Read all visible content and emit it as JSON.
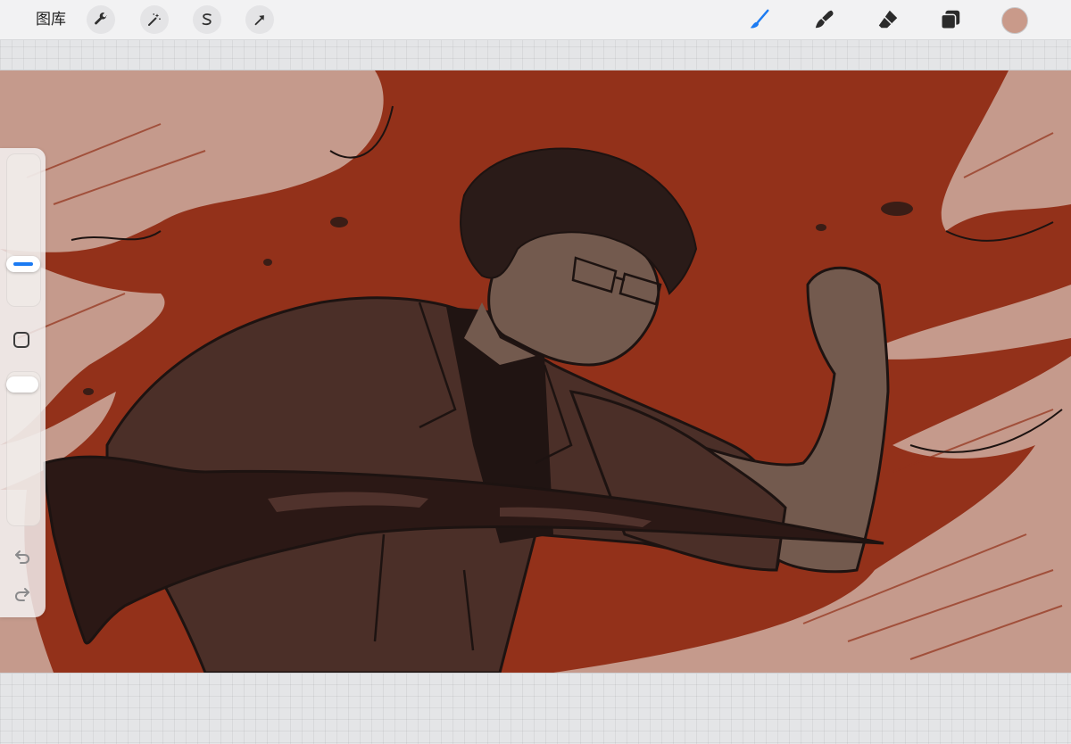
{
  "topbar": {
    "gallery_label": "图库",
    "left_tools": [
      {
        "name": "actions",
        "icon": "wrench-icon"
      },
      {
        "name": "adjustments",
        "icon": "magic-wand-icon"
      },
      {
        "name": "selection",
        "icon": "selection-s-icon"
      },
      {
        "name": "transform",
        "icon": "arrow-cursor-icon"
      }
    ],
    "right_tools": [
      {
        "name": "brush",
        "icon": "brush-icon",
        "active": true
      },
      {
        "name": "smudge",
        "icon": "smudge-icon",
        "active": false
      },
      {
        "name": "eraser",
        "icon": "eraser-icon",
        "active": false
      },
      {
        "name": "layers",
        "icon": "layers-icon",
        "active": false
      }
    ],
    "current_color": "#c99a8a",
    "active_color": "#1c7bf2"
  },
  "sidebar": {
    "brush_size_level": 0.75,
    "opacity_level": 1.0,
    "modify_icon": "square-icon",
    "undo_icon": "undo-arrow-icon",
    "redo_icon": "redo-arrow-icon"
  },
  "canvas": {
    "artwork": "illustration-man-with-glasses",
    "colors": {
      "background_red": "#93311a",
      "streak_pink": "#c59a8c",
      "jacket": "#4b2f28",
      "skin": "#735a4e",
      "hair": "#2a1b18",
      "scarf": "#2b1815",
      "lineart": "#1d1311"
    }
  }
}
